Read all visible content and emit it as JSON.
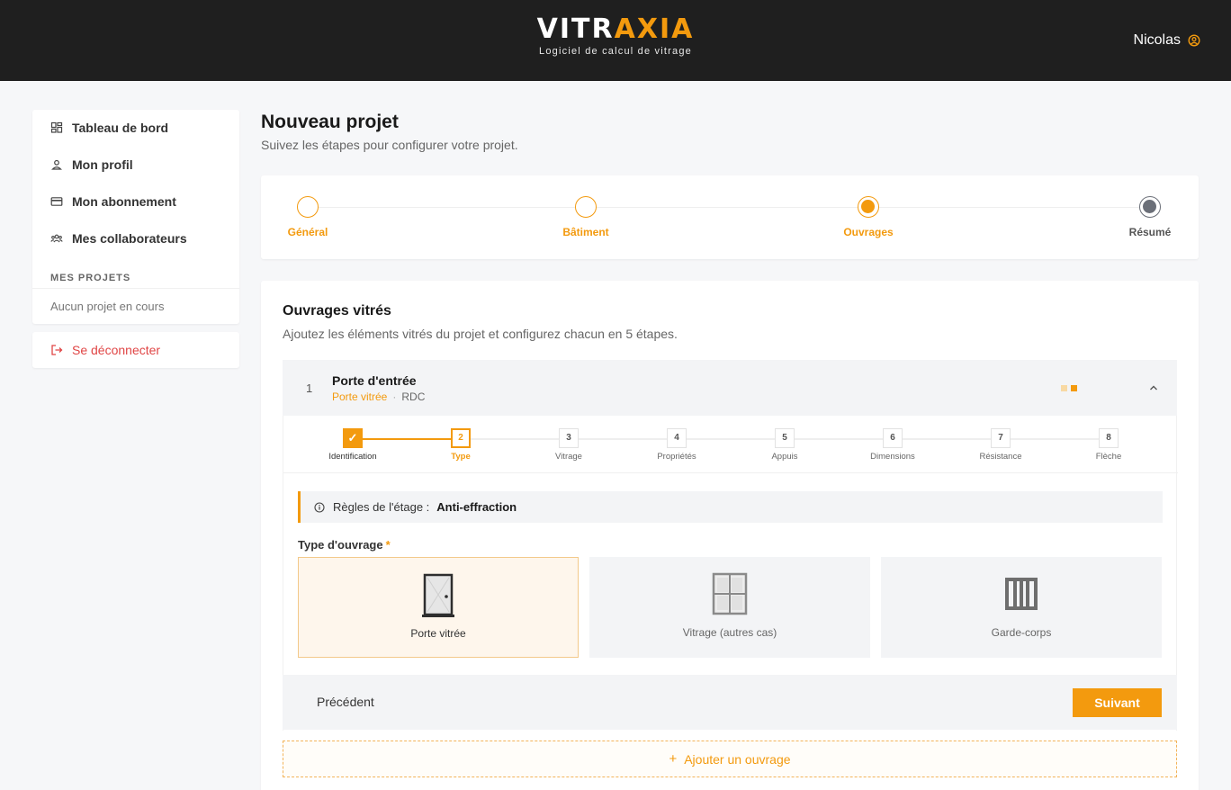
{
  "header": {
    "logo_part1": "VITR",
    "logo_part2": "AXIA",
    "tagline": "Logiciel de calcul de vitrage",
    "user_name": "Nicolas"
  },
  "sidebar": {
    "items": [
      {
        "label": "Tableau de bord",
        "icon": "dashboard-icon"
      },
      {
        "label": "Mon profil",
        "icon": "user-icon"
      },
      {
        "label": "Mon abonnement",
        "icon": "card-icon"
      },
      {
        "label": "Mes collaborateurs",
        "icon": "team-icon"
      }
    ],
    "section_title": "MES PROJETS",
    "empty_text": "Aucun projet en cours",
    "logout_label": "Se déconnecter"
  },
  "page": {
    "title": "Nouveau projet",
    "subtitle": "Suivez les étapes pour configurer votre projet."
  },
  "stepper": {
    "steps": [
      {
        "label": "Général",
        "state": "done"
      },
      {
        "label": "Bâtiment",
        "state": "done"
      },
      {
        "label": "Ouvrages",
        "state": "active"
      },
      {
        "label": "Résumé",
        "state": "pending"
      }
    ]
  },
  "section": {
    "title": "Ouvrages vitrés",
    "subtitle": "Ajoutez les éléments vitrés du projet et configurez chacun en 5 étapes."
  },
  "item": {
    "number": "1",
    "name": "Porte d'entrée",
    "type": "Porte vitrée",
    "separator": "·",
    "level": "RDC"
  },
  "sub_stepper": {
    "steps": [
      {
        "num": "✓",
        "label": "Identification",
        "state": "done"
      },
      {
        "num": "2",
        "label": "Type",
        "state": "current"
      },
      {
        "num": "3",
        "label": "Vitrage",
        "state": "todo"
      },
      {
        "num": "4",
        "label": "Propriétés",
        "state": "todo"
      },
      {
        "num": "5",
        "label": "Appuis",
        "state": "todo"
      },
      {
        "num": "6",
        "label": "Dimensions",
        "state": "todo"
      },
      {
        "num": "7",
        "label": "Résistance",
        "state": "todo"
      },
      {
        "num": "8",
        "label": "Flèche",
        "state": "todo"
      }
    ]
  },
  "rule": {
    "label": "Règles de l'étage :",
    "value": "Anti-effraction"
  },
  "type_field": {
    "label": "Type d'ouvrage",
    "required_mark": "*",
    "options": [
      {
        "label": "Porte vitrée",
        "icon": "door-icon",
        "selected": true
      },
      {
        "label": "Vitrage (autres cas)",
        "icon": "window-icon",
        "selected": false
      },
      {
        "label": "Garde-corps",
        "icon": "railing-icon",
        "selected": false
      }
    ]
  },
  "footer": {
    "prev_label": "Précédent",
    "next_label": "Suivant"
  },
  "add": {
    "plus": "+",
    "label": "Ajouter un ouvrage"
  },
  "colors": {
    "accent": "#f39a0e",
    "header_bg": "#1f1f1f",
    "danger": "#e04545"
  }
}
